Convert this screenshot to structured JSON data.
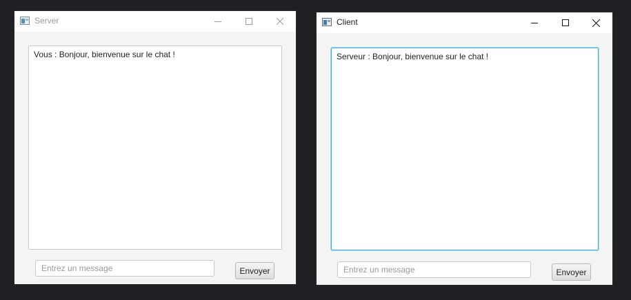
{
  "server_window": {
    "title": "Server",
    "active": false,
    "icon": "java-app-icon",
    "controls": [
      "minimize-icon",
      "maximize-icon",
      "close-icon"
    ],
    "chat_text": "Vous : Bonjour, bienvenue sur le chat !",
    "input_placeholder": "Entrez un message",
    "input_value": "",
    "send_label": "Envoyer"
  },
  "client_window": {
    "title": "Client",
    "active": true,
    "icon": "java-app-icon",
    "controls": [
      "minimize-icon",
      "maximize-icon",
      "close-icon"
    ],
    "chat_text": "Serveur : Bonjour, bienvenue sur le chat !",
    "input_placeholder": "Entrez un message",
    "input_value": "",
    "send_label": "Envoyer"
  },
  "colors": {
    "desktop": "#1f2023",
    "window_bg": "#f4f4f4",
    "focus_ring": "#3fb4d9"
  }
}
